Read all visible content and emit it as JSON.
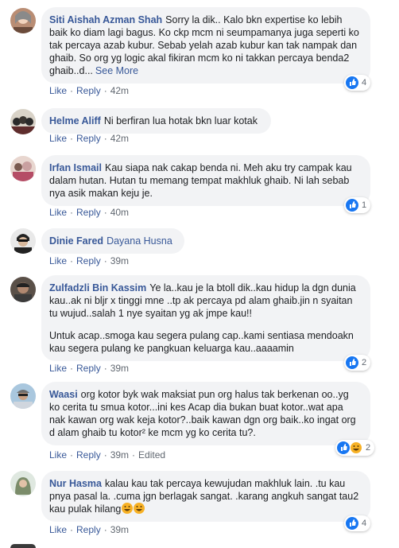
{
  "actions": {
    "like": "Like",
    "reply": "Reply",
    "edited": "Edited"
  },
  "comments": [
    {
      "author": "Siti Aishah Azman Shah",
      "text": "Sorry la dik.. Kalo bkn expertise ko lebih baik ko diam lagi bagus. Ko ckp mcm ni seumpamanya juga seperti ko tak percaya azab kubur. Sebab yelah azab kubur kan tak nampak dan ghaib. So org yg logic akal fikiran mcm ko ni takkan percaya benda2 ghaib..d...",
      "see_more": "See More",
      "time": "42m",
      "reactions": "4"
    },
    {
      "author": "Helme Aliff",
      "text": "Ni berfiran lua hotak bkn luar kotak",
      "time": "42m"
    },
    {
      "author": "Irfan Ismail",
      "text": "Kau siapa nak cakap benda ni. Meh aku try campak kau dalam hutan. Hutan tu memang tempat makhluk ghaib. Ni lah sebab nya asik makan keju je.",
      "time": "40m",
      "reactions": "1"
    },
    {
      "author": "Dinie Fared",
      "tag": "Dayana Husna",
      "time": "39m"
    },
    {
      "author": "Zulfadzli Bin Kassim",
      "text": "Ye la..kau je la btoll dik..kau hidup la dgn dunia kau..ak ni bljr x tinggi mne ..tp ak percaya pd alam ghaib.jin n syaitan tu wujud..salah 1 nye syaitan yg ak jmpe kau!!",
      "text2": "Untuk acap..smoga kau segera pulang cap..kami sentiasa mendoakn kau segera pulang ke pangkuan keluarga kau..aaaamin",
      "time": "39m",
      "reactions": "2"
    },
    {
      "author": "Waasi",
      "text": "org kotor byk wak maksiat pun org halus tak berkenan oo..yg ko cerita tu smua kotor...ini kes Acap dia bukan buat kotor..wat apa nak kawan org wak keja kotor?..baik kawan dgn org baik..ko ingat org d alam ghaib tu kotor² ke mcm yg ko cerita tu?.",
      "time": "39m",
      "reactions": "2"
    },
    {
      "author": "Nur Hasma",
      "text": "kalau kau tak percaya kewujudan makhluk lain. .tu kau pnya pasal la. .cuma jgn berlagak sangat. .karang angkuh sangat tau2 kau pulak hilang",
      "time": "39m",
      "reactions": "4"
    }
  ]
}
